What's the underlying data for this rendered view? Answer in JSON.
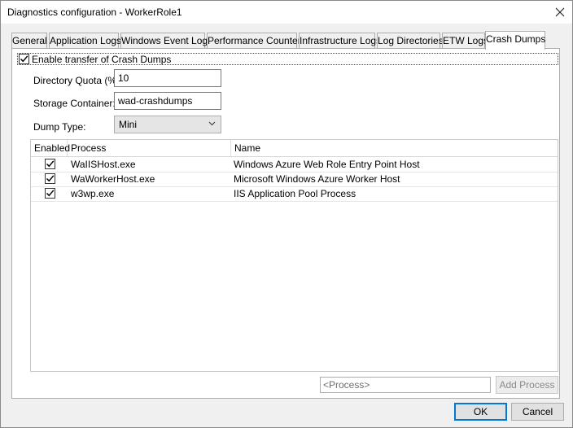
{
  "window": {
    "title": "Diagnostics configuration - WorkerRole1"
  },
  "tabs": [
    {
      "label": "General"
    },
    {
      "label": "Application Logs"
    },
    {
      "label": "Windows Event Logs"
    },
    {
      "label": "Performance Counters"
    },
    {
      "label": "Infrastructure Logs"
    },
    {
      "label": "Log Directories"
    },
    {
      "label": "ETW Logs"
    },
    {
      "label": "Crash Dumps",
      "active": true
    }
  ],
  "crash_dumps": {
    "enable_label": "Enable transfer of Crash Dumps",
    "enable_checked": true,
    "directory_quota_label": "Directory Quota (%):",
    "directory_quota_value": "10",
    "storage_container_label": "Storage Container:",
    "storage_container_value": "wad-crashdumps",
    "dump_type_label": "Dump Type:",
    "dump_type_value": "Mini",
    "table": {
      "headers": [
        "Enabled",
        "Process",
        "Name"
      ],
      "rows": [
        {
          "enabled": true,
          "process": "WaIISHost.exe",
          "name": "Windows Azure Web Role Entry Point Host"
        },
        {
          "enabled": true,
          "process": "WaWorkerHost.exe",
          "name": "Microsoft Windows Azure Worker Host"
        },
        {
          "enabled": true,
          "process": "w3wp.exe",
          "name": "IIS Application Pool Process"
        }
      ]
    },
    "process_placeholder": "<Process>",
    "add_process_label": "Add Process"
  },
  "footer": {
    "ok_label": "OK",
    "cancel_label": "Cancel"
  },
  "colors": {
    "accent": "#0078d7",
    "background": "#f0f0f0",
    "panel": "#ffffff"
  }
}
